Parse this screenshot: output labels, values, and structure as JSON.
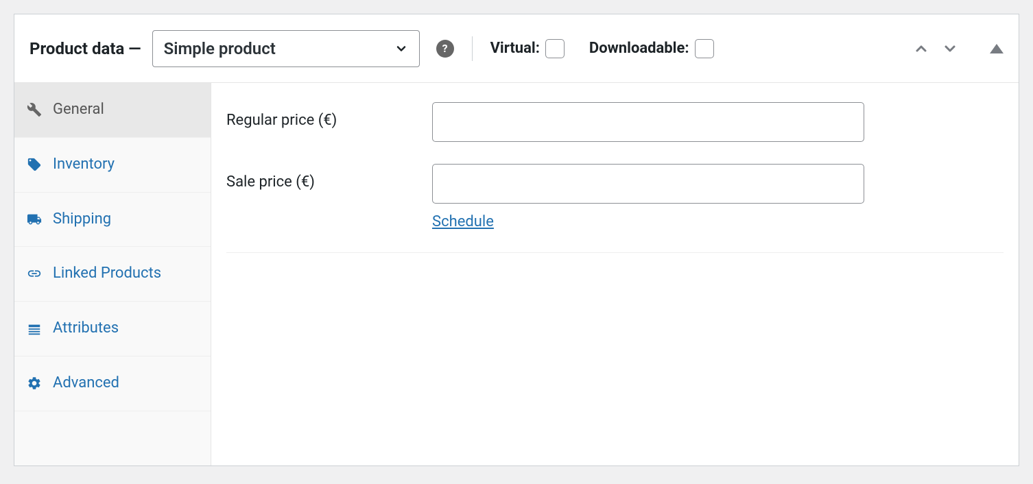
{
  "header": {
    "title": "Product data —",
    "product_type": "Simple product",
    "virtual_label": "Virtual:",
    "downloadable_label": "Downloadable:"
  },
  "sidebar": {
    "items": [
      {
        "label": "General",
        "icon": "wrench",
        "active": true
      },
      {
        "label": "Inventory",
        "icon": "tags",
        "active": false
      },
      {
        "label": "Shipping",
        "icon": "truck",
        "active": false
      },
      {
        "label": "Linked Products",
        "icon": "link",
        "active": false
      },
      {
        "label": "Attributes",
        "icon": "list",
        "active": false
      },
      {
        "label": "Advanced",
        "icon": "gear",
        "active": false
      }
    ]
  },
  "general": {
    "regular_price_label": "Regular price (€)",
    "regular_price_value": "",
    "sale_price_label": "Sale price (€)",
    "sale_price_value": "",
    "schedule_label": "Schedule"
  }
}
